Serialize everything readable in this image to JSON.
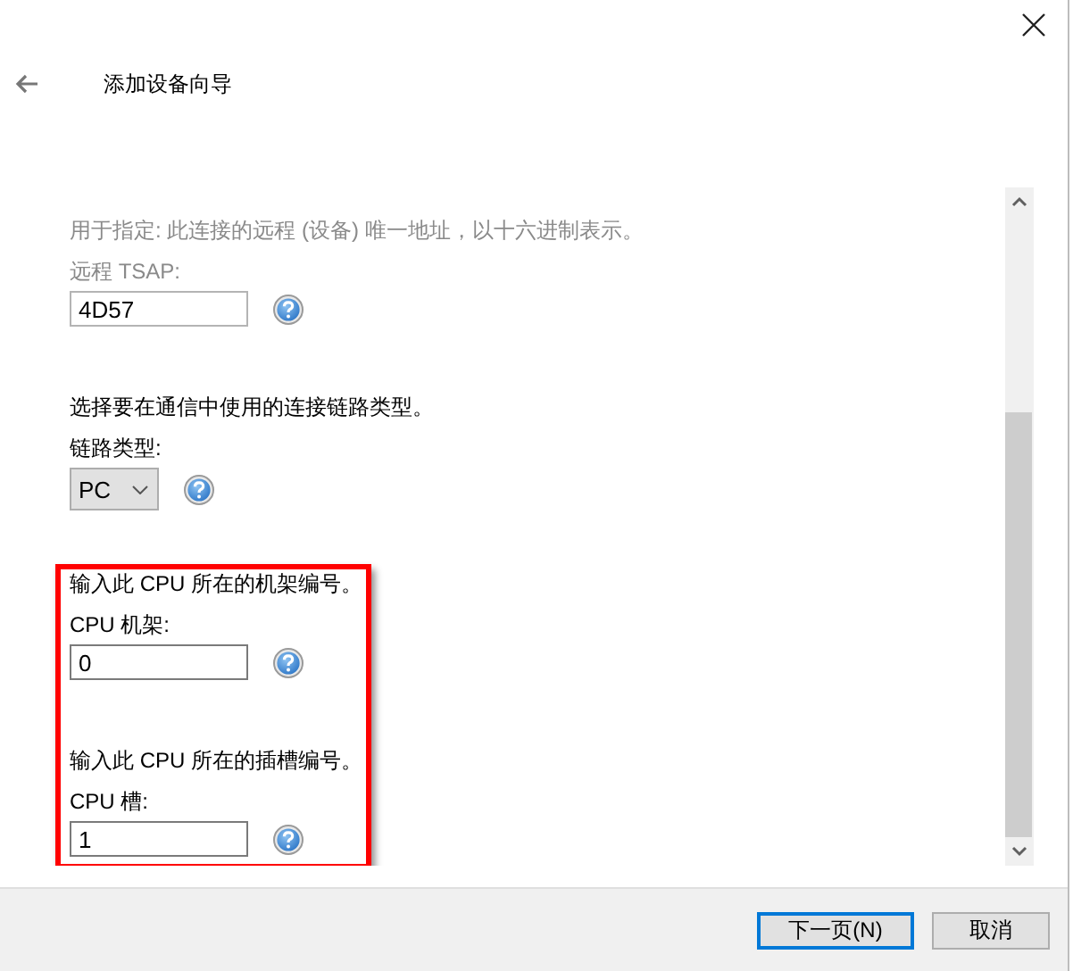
{
  "window": {
    "title": "添加设备向导"
  },
  "groups": [
    {
      "highlighted": false,
      "fields": [
        {
          "kind": "text",
          "disabled": true,
          "description": "用于指定: 此连接的远程 (设备) 唯一地址，以十六进制表示。",
          "label": "远程 TSAP:",
          "value": "4D57"
        },
        {
          "kind": "select",
          "disabled": false,
          "description": "选择要在通信中使用的连接链路类型。",
          "label": "链路类型:",
          "value": "PC"
        }
      ]
    },
    {
      "highlighted": true,
      "fields": [
        {
          "kind": "text",
          "disabled": false,
          "description": "输入此 CPU 所在的机架编号。",
          "label": "CPU 机架:",
          "value": "0"
        },
        {
          "kind": "text",
          "disabled": false,
          "description": "输入此 CPU 所在的插槽编号。",
          "label": "CPU 槽:",
          "value": "1"
        }
      ]
    }
  ],
  "buttons": [
    {
      "label": "下一页(N)",
      "default": true
    },
    {
      "label": "取消",
      "default": false
    }
  ]
}
